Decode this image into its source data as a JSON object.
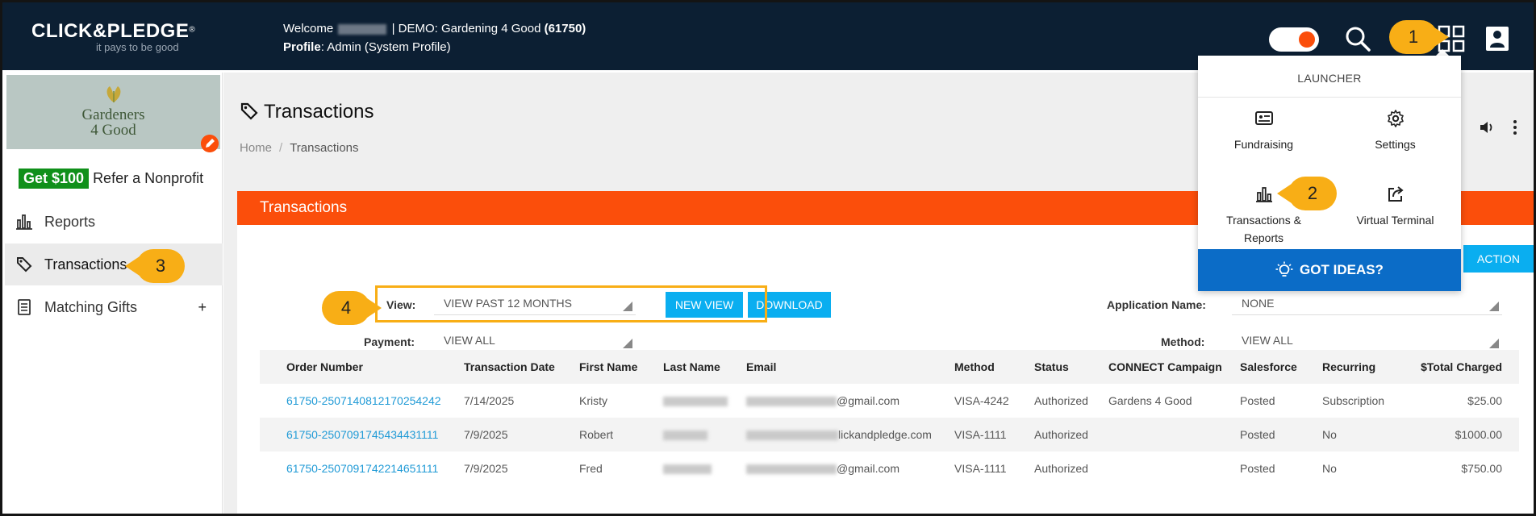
{
  "header": {
    "logo_main": "CLICK&PLEDGE",
    "logo_mark": "®",
    "logo_tagline": "it pays to be good",
    "welcome_prefix": "Welcome",
    "welcome_org": "| DEMO: Gardening 4 Good",
    "welcome_org_id": "(61750)",
    "profile_label": "Profile",
    "profile_value": ": Admin (System Profile)"
  },
  "callouts": {
    "c1": "1",
    "c2": "2",
    "c3": "3",
    "c4": "4"
  },
  "sidebar": {
    "org_name_line1": "Gardeners",
    "org_name_line2": "4 Good",
    "refer_chip": "Get $100",
    "refer_text": "Refer a Nonprofit",
    "items": [
      {
        "label": "Reports"
      },
      {
        "label": "Transactions"
      },
      {
        "label": "Matching Gifts",
        "expand": "+"
      }
    ]
  },
  "main": {
    "title": "Transactions",
    "breadcrumb": {
      "home": "Home",
      "sep": "/",
      "current": "Transactions"
    },
    "panel_title": "Transactions",
    "add_button": "ACTION",
    "filters": {
      "view_label": "View:",
      "view_value": "VIEW PAST 12 MONTHS",
      "new_view": "NEW VIEW",
      "download": "DOWNLOAD",
      "payment_label": "Payment:",
      "payment_value": "VIEW ALL",
      "app_name_label": "Application Name:",
      "app_name_value": "NONE",
      "method_label": "Method:",
      "method_value": "VIEW ALL"
    },
    "table": {
      "columns": [
        "Order Number",
        "Transaction Date",
        "First Name",
        "Last Name",
        "Email",
        "Method",
        "Status",
        "CONNECT Campaign",
        "Salesforce",
        "Recurring",
        "$Total Charged"
      ],
      "rows": [
        {
          "order": "61750-2507140812170254242",
          "date": "7/14/2025",
          "first": "Kristy",
          "email_suffix": "@gmail.com",
          "method": "VISA-4242",
          "status": "Authorized",
          "campaign": "Gardens 4 Good",
          "salesforce": "Posted",
          "recurring": "Subscription",
          "total": "$25.00"
        },
        {
          "order": "61750-2507091745434431111",
          "date": "7/9/2025",
          "first": "Robert",
          "email_suffix": "lickandpledge.com",
          "method": "VISA-1111",
          "status": "Authorized",
          "campaign": "",
          "salesforce": "Posted",
          "recurring": "No",
          "total": "$1000.00"
        },
        {
          "order": "61750-2507091742214651111",
          "date": "7/9/2025",
          "first": "Fred",
          "email_suffix": "@gmail.com",
          "method": "VISA-1111",
          "status": "Authorized",
          "campaign": "",
          "salesforce": "Posted",
          "recurring": "No",
          "total": "$750.00"
        }
      ]
    }
  },
  "launcher": {
    "heading": "LAUNCHER",
    "tiles": [
      {
        "label": "Fundraising",
        "icon": "id-card-icon"
      },
      {
        "label": "Settings",
        "icon": "gear-icon"
      },
      {
        "label_line1": "Transactions &",
        "label_line2": "Reports",
        "icon": "bar-chart-icon"
      },
      {
        "label": "Virtual Terminal",
        "icon": "share-box-icon"
      }
    ],
    "ideas": "GOT IDEAS?"
  },
  "colors": {
    "header_bg": "#0c1f33",
    "accent_orange": "#fb4e0b",
    "callout_yellow": "#f8ae16",
    "button_blue": "#0aaef0",
    "ideas_blue": "#0b6cc7",
    "link_blue": "#1f9ad6"
  }
}
